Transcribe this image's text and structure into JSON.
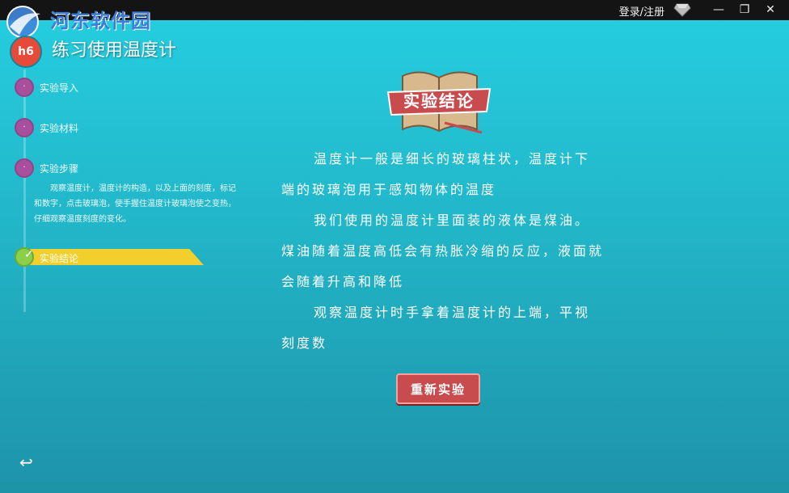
{
  "topbar": {
    "login_label": "登录/注册",
    "minimize_label": "—",
    "restore_label": "❐",
    "close_label": "✕"
  },
  "watermark": {
    "site_name": "河东软件园"
  },
  "header": {
    "badge_text": "h6",
    "title": "练习使用温度计"
  },
  "sidebar": {
    "steps": [
      {
        "label": "实验导入",
        "state": "done"
      },
      {
        "label": "实验材料",
        "state": "done"
      },
      {
        "label": "实验步骤",
        "state": "done"
      }
    ],
    "step_description": "观察温度计，温度计的构造，以及上面的刻度，标记和数字，点击玻璃泡，使手握住温度计玻璃泡使之变热，仔细观察温度刻度的变化。",
    "active_step": {
      "label": "实验结论",
      "check": "✓"
    },
    "back_icon": "↩"
  },
  "main": {
    "section_title": "实验结论",
    "paragraphs": [
      {
        "text": "温度计一般是细长的玻璃柱状，温度计下端的玻璃泡用于感知物体的温度",
        "indent": true
      },
      {
        "text": "我们使用的温度计里面装的液体是煤油。煤油随着温度高低会有热胀冷缩的反应，液面就会随着升高和降低",
        "indent": true
      },
      {
        "text": "观察温度计时手拿着温度计的上端，平视刻度数",
        "indent": true
      }
    ],
    "restart_label": "重新实验"
  },
  "colors": {
    "accent_yellow": "#f2cf2c",
    "button_red": "#c84b4e",
    "step_dot": "#a8509e",
    "active_dot": "#8ccf4a"
  }
}
